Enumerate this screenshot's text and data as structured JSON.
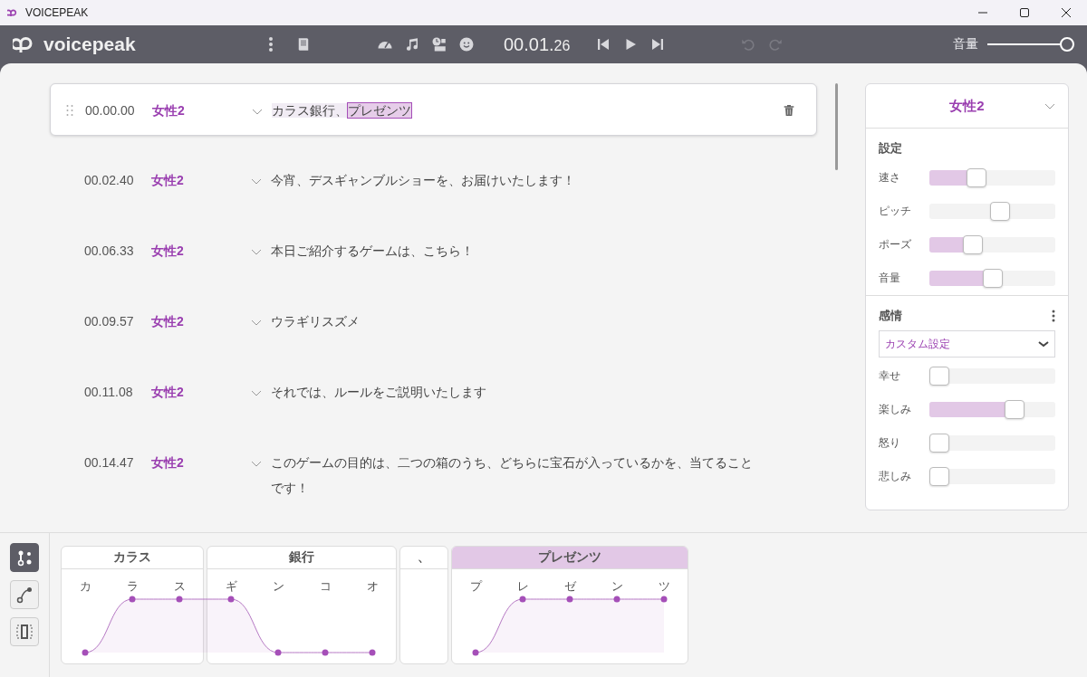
{
  "window": {
    "title": "VOICEPEAK"
  },
  "toolbar": {
    "logo": "voicepeak",
    "time": "00.01.",
    "time_fraction": "26",
    "undo_disabled": true,
    "redo_disabled": true,
    "volume_label": "音量",
    "volume": {
      "level": 1
    }
  },
  "lines": [
    {
      "time": "00.00.00",
      "voice": "女性2",
      "selected": true,
      "segments": [
        {
          "text": "カラス銀行、",
          "selected": false
        },
        {
          "text": "プレゼンツ",
          "selected": true
        }
      ]
    },
    {
      "time": "00.02.40",
      "voice": "女性2",
      "selected": false,
      "segments": [
        {
          "text": "今宵、デスギャンブルショーを、お届けいたします！",
          "selected": false
        }
      ]
    },
    {
      "time": "00.06.33",
      "voice": "女性2",
      "selected": false,
      "segments": [
        {
          "text": "本日ご紹介するゲームは、こちら！",
          "selected": false
        }
      ]
    },
    {
      "time": "00.09.57",
      "voice": "女性2",
      "selected": false,
      "segments": [
        {
          "text": "ウラギリスズメ",
          "selected": false
        }
      ]
    },
    {
      "time": "00.11.08",
      "voice": "女性2",
      "selected": false,
      "segments": [
        {
          "text": "それでは、ルールをご説明いたします",
          "selected": false
        }
      ]
    },
    {
      "time": "00.14.47",
      "voice": "女性2",
      "selected": false,
      "segments": [
        {
          "text": "このゲームの目的は、二つの箱のうち、どちらに宝石が入っているかを、当てることです！",
          "selected": false
        }
      ]
    }
  ],
  "panel": {
    "voice": "女性2",
    "settings_title": "設定",
    "settings": [
      {
        "label": "速さ",
        "kind": "fill",
        "level": 0.35
      },
      {
        "label": "ピッチ",
        "kind": "center",
        "level": 0.57
      },
      {
        "label": "ポーズ",
        "kind": "fill",
        "level": 0.32
      },
      {
        "label": "音量",
        "kind": "fill",
        "level": 0.5
      }
    ],
    "emotion_title": "感情",
    "preset": "カスタム設定",
    "emotions": [
      {
        "label": "幸せ",
        "level": 0
      },
      {
        "label": "楽しみ",
        "level": 0.71
      },
      {
        "label": "怒り",
        "level": 0
      },
      {
        "label": "悲しみ",
        "level": 0
      }
    ]
  },
  "tools": [
    {
      "selected": true
    },
    {
      "selected": false
    },
    {
      "selected": false
    }
  ],
  "words": [
    {
      "text": "カラス",
      "selected": false,
      "morae": [
        {
          "text": "カ",
          "high": false
        },
        {
          "text": "ラ",
          "high": true
        },
        {
          "text": "ス",
          "high": true
        }
      ]
    },
    {
      "text": "銀行",
      "selected": false,
      "morae": [
        {
          "text": "ギ",
          "high": true
        },
        {
          "text": "ン",
          "high": false
        },
        {
          "text": "コ",
          "high": false
        },
        {
          "text": "オ",
          "high": false
        }
      ]
    },
    {
      "text": "、",
      "selected": false
    },
    {
      "text": "プレゼンツ",
      "selected": true,
      "morae": [
        {
          "text": "プ",
          "high": false
        },
        {
          "text": "レ",
          "high": true
        },
        {
          "text": "ゼ",
          "high": true
        },
        {
          "text": "ン",
          "high": true
        },
        {
          "text": "ツ",
          "high": true
        }
      ]
    }
  ]
}
